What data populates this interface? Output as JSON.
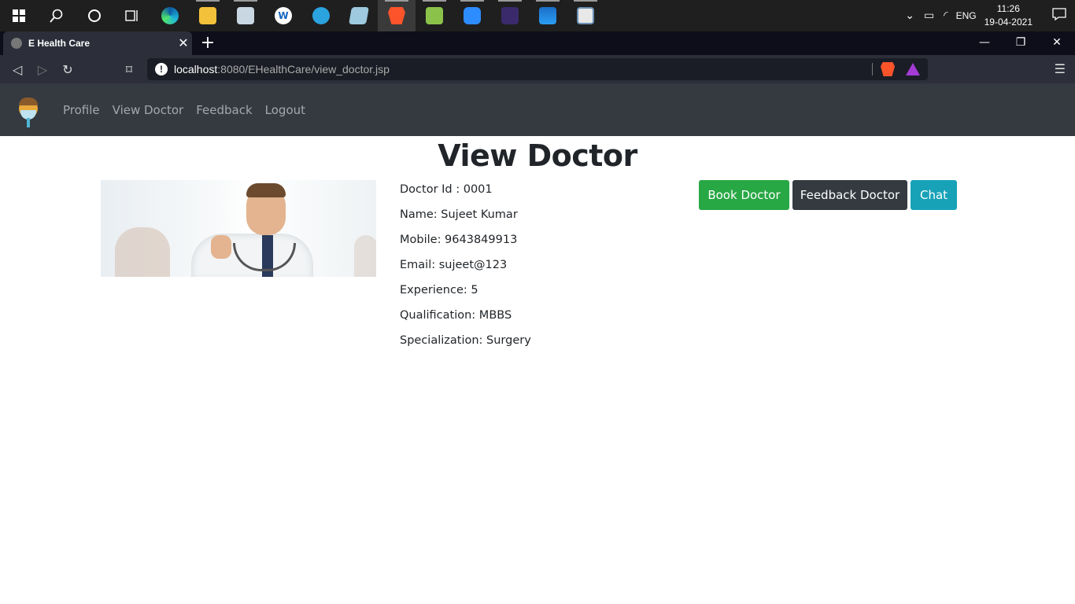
{
  "taskbar": {
    "icons": [
      "windows-start-icon",
      "search-icon",
      "cortana-icon",
      "task-view-icon",
      "edge-icon",
      "file-explorer-icon",
      "photos-app-icon",
      "app-w-icon",
      "telegram-icon",
      "notepad-icon",
      "brave-icon",
      "notepad-plus-icon",
      "zoom-icon",
      "game-icon",
      "photos-icon",
      "window-app-icon"
    ],
    "tray": {
      "lang": "ENG",
      "time": "11:26",
      "date": "19-04-2021"
    }
  },
  "browser": {
    "tab_title": "E Health Care",
    "url_host": "localhost",
    "url_path": ":8080/EHealthCare/view_doctor.jsp"
  },
  "site": {
    "nav": {
      "profile": "Profile",
      "view_doctor": "View Doctor",
      "feedback": "Feedback",
      "logout": "Logout"
    },
    "page_title": "View Doctor",
    "doctor": {
      "id": "Doctor Id : 0001",
      "name": "Name: Sujeet Kumar",
      "mobile": "Mobile: 9643849913",
      "email": "Email: sujeet@123",
      "experience": "Experience: 5",
      "qualification": "Qualification: MBBS",
      "specialization": "Specialization: Surgery"
    },
    "buttons": {
      "book": "Book Doctor",
      "feedback": "Feedback Doctor",
      "chat": "Chat"
    }
  },
  "colors": {
    "navbar": "#343a40",
    "book_button": "#28a745",
    "feedback_button": "#343a40",
    "chat_button": "#17a2b8"
  }
}
